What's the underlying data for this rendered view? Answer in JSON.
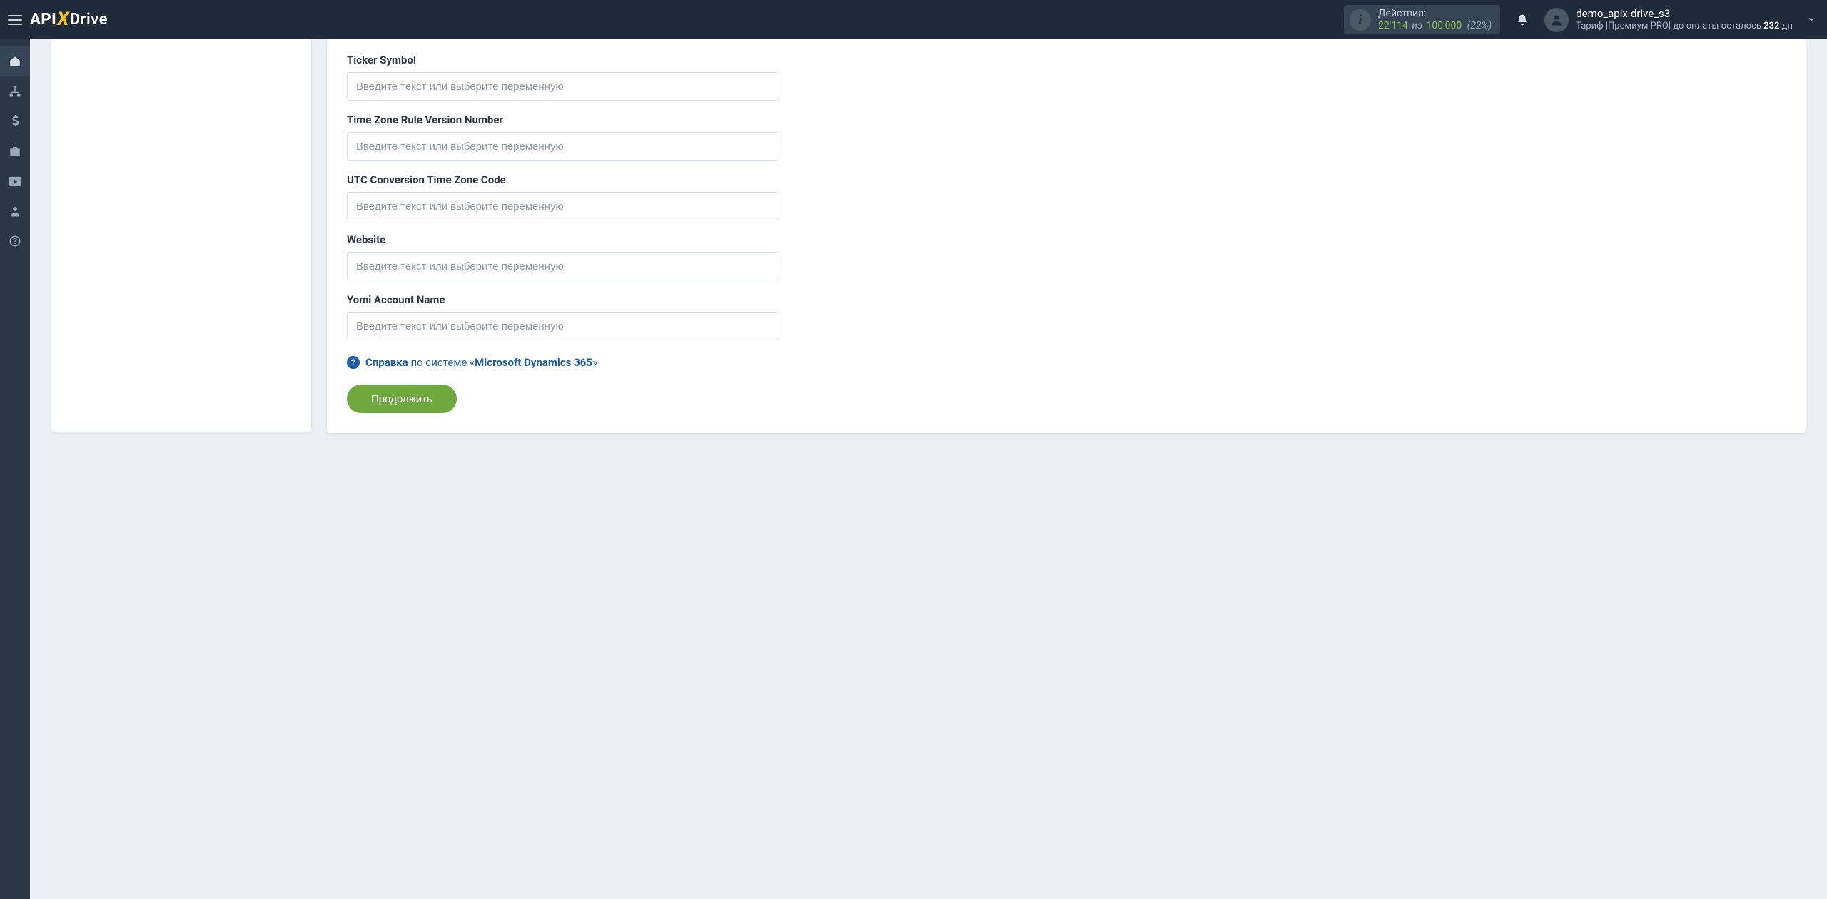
{
  "logo": {
    "api": "API",
    "x": "X",
    "drive": "Drive"
  },
  "header": {
    "actions_label": "Действия:",
    "actions_used": "22'114",
    "actions_sep": "из",
    "actions_total": "100'000",
    "actions_pct": "(22%)"
  },
  "account": {
    "name": "demo_apix-drive_s3",
    "tariff_prefix": "Тариф |",
    "tariff_name": "Премиум PRO",
    "tariff_suffix": "|  до оплаты осталось ",
    "days": "232",
    "days_unit": " дн"
  },
  "form": {
    "placeholder": "Введите текст или выберите переменную",
    "fields": [
      {
        "label": "Ticker Symbol"
      },
      {
        "label": "Time Zone Rule Version Number"
      },
      {
        "label": "UTC Conversion Time Zone Code"
      },
      {
        "label": "Website"
      },
      {
        "label": "Yomi Account Name"
      }
    ],
    "help_word": "Справка",
    "help_mid": " по системе «",
    "help_system": "Microsoft Dynamics 365",
    "help_close": "»",
    "submit": "Продолжить"
  }
}
